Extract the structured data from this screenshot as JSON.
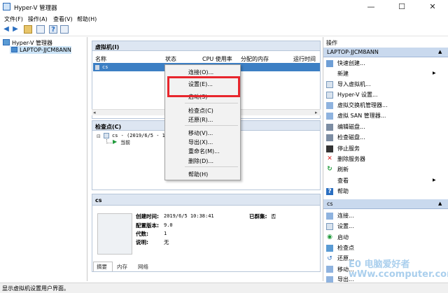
{
  "window": {
    "title": "Hyper-V 管理器",
    "minimize": "—",
    "maximize": "☐",
    "close": "✕"
  },
  "menu": [
    "文件(F)",
    "操作(A)",
    "查看(V)",
    "帮助(H)"
  ],
  "tree": {
    "root": "Hyper-V 管理器",
    "host": "LAPTOP-JJCM8ANN"
  },
  "vm_panel": {
    "title": "虚拟机(I)",
    "columns": [
      "名称",
      "状态",
      "CPU 使用率",
      "分配的内存",
      "运行时间"
    ],
    "row": {
      "name": "cs",
      "state": "关"
    }
  },
  "checkpoint_panel": {
    "title": "检查点(C)",
    "entry": "cs - (2019/6/5 - 11:12:",
    "now": "当前"
  },
  "detail_panel": {
    "title": "cs",
    "created_label": "创建时间:",
    "created_value": "2019/6/5 10:38:41",
    "clustered_label": "已群集:",
    "clustered_value": "否",
    "config_label": "配置版本:",
    "config_value": "9.0",
    "gen_label": "代数:",
    "gen_value": "1",
    "notes_label": "说明:",
    "notes_value": "无",
    "tabs": [
      "摘要",
      "内存",
      "网络"
    ]
  },
  "context_menu": {
    "items": [
      "连接(O)...",
      "设置(E)...",
      "启动(S)",
      "检查点(C)",
      "还原(R)...",
      "移动(V)...",
      "导出(X)...",
      "重命名(M)...",
      "删除(D)...",
      "帮助(H)"
    ]
  },
  "actions": {
    "title": "操作",
    "host": "LAPTOP-JJCM8ANN",
    "host_items": [
      "快速创建...",
      "新建",
      "导入虚拟机...",
      "Hyper-V 设置...",
      "虚拟交换机管理器...",
      "虚拟 SAN 管理器...",
      "编辑磁盘...",
      "检查磁盘...",
      "停止服务",
      "删除服务器",
      "刷新",
      "查看",
      "帮助"
    ],
    "vm": "cs",
    "vm_items": [
      "连接...",
      "设置...",
      "启动",
      "检查点",
      "还原...",
      "移动...",
      "导出..."
    ]
  },
  "status": "显示虚拟机设置用户界面。",
  "watermark": "E0 电脑爱好者 wWw.ccomputer.com",
  "colors": {
    "accent": "#3c7fc4",
    "red": "#e8262d",
    "select": "#3c7fc4"
  }
}
